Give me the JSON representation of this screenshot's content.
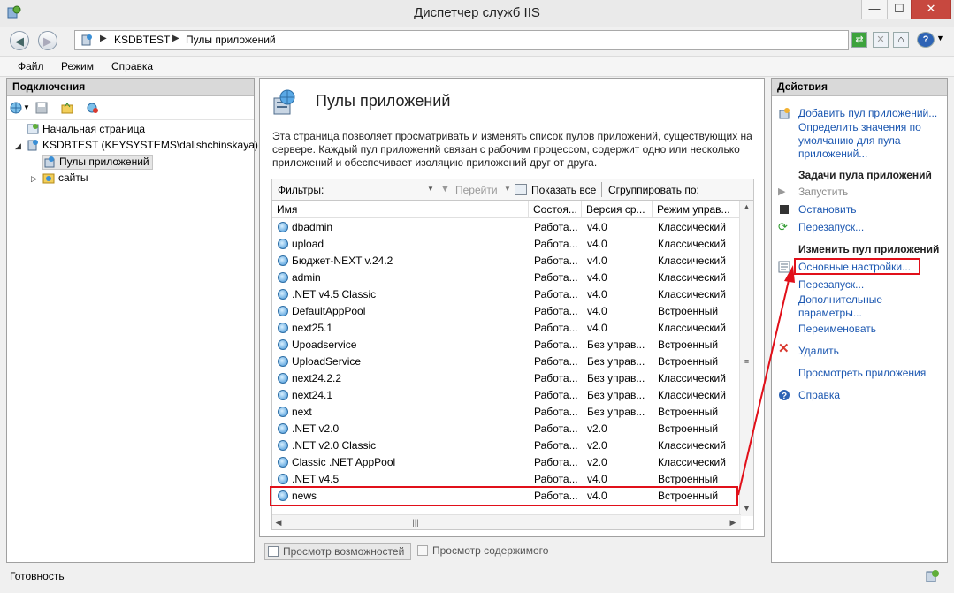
{
  "window": {
    "title": "Диспетчер служб IIS",
    "minimize": "—",
    "maximize": "☐",
    "close": "✕"
  },
  "address": {
    "crumbs": [
      "KSDBTEST",
      "Пулы приложений"
    ],
    "sep": "▶"
  },
  "menu": [
    "Файл",
    "Режим",
    "Справка"
  ],
  "connections": {
    "header": "Подключения",
    "tree": [
      {
        "label": "Начальная страница"
      },
      {
        "label": "KSDBTEST (KEYSYSTEMS\\dalishchinskaya)"
      },
      {
        "label": "Пулы приложений"
      },
      {
        "label": "сайты"
      }
    ]
  },
  "main": {
    "title": "Пулы приложений",
    "description": "Эта страница позволяет просматривать и изменять список пулов приложений, существующих на сервере. Каждый пул приложений связан с рабочим процессом, содержит одно или несколько приложений и обеспечивает изоляцию приложений друг от друга.",
    "filter": {
      "label": "Фильтры:",
      "go": "Перейти",
      "show_all": "Показать все",
      "group_by": "Сгруппировать по:"
    },
    "columns": [
      "Имя",
      "Состоя...",
      "Версия ср...",
      "Режим управ..."
    ],
    "rows": [
      [
        "dbadmin",
        "Работа...",
        "v4.0",
        "Классический"
      ],
      [
        "upload",
        "Работа...",
        "v4.0",
        "Классический"
      ],
      [
        "Бюджет-NEXT v.24.2",
        "Работа...",
        "v4.0",
        "Классический"
      ],
      [
        "admin",
        "Работа...",
        "v4.0",
        "Классический"
      ],
      [
        ".NET v4.5 Classic",
        "Работа...",
        "v4.0",
        "Классический"
      ],
      [
        "DefaultAppPool",
        "Работа...",
        "v4.0",
        "Встроенный"
      ],
      [
        "next25.1",
        "Работа...",
        "v4.0",
        "Классический"
      ],
      [
        "Upoadservice",
        "Работа...",
        "Без управ...",
        "Встроенный"
      ],
      [
        "UploadService",
        "Работа...",
        "Без управ...",
        "Встроенный"
      ],
      [
        "next24.2.2",
        "Работа...",
        "Без управ...",
        "Классический"
      ],
      [
        "next24.1",
        "Работа...",
        "Без управ...",
        "Классический"
      ],
      [
        "next",
        "Работа...",
        "Без управ...",
        "Встроенный"
      ],
      [
        ".NET v2.0",
        "Работа...",
        "v2.0",
        "Встроенный"
      ],
      [
        ".NET v2.0 Classic",
        "Работа...",
        "v2.0",
        "Классический"
      ],
      [
        "Classic .NET AppPool",
        "Работа...",
        "v2.0",
        "Классический"
      ],
      [
        ".NET v4.5",
        "Работа...",
        "v4.0",
        "Встроенный"
      ],
      [
        "news",
        "Работа...",
        "v4.0",
        "Встроенный"
      ]
    ],
    "views": {
      "features": "Просмотр возможностей",
      "content": "Просмотр содержимого"
    }
  },
  "actions": {
    "header": "Действия",
    "add_pool": "Добавить пул приложений...",
    "set_defaults": "Определить значения по умолчанию для пула приложений...",
    "tasks_header": "Задачи пула приложений",
    "start": "Запустить",
    "stop": "Остановить",
    "recycle": "Перезапуск...",
    "edit_header": "Изменить пул приложений",
    "basic_settings": "Основные настройки...",
    "recycling": "Перезапуск...",
    "advanced": "Дополнительные параметры...",
    "rename": "Переименовать",
    "remove": "Удалить",
    "view_apps": "Просмотреть приложения",
    "help": "Справка"
  },
  "status": {
    "text": "Готовность"
  },
  "colors": {
    "highlight": "#e1101a",
    "link": "#1a56b0"
  }
}
